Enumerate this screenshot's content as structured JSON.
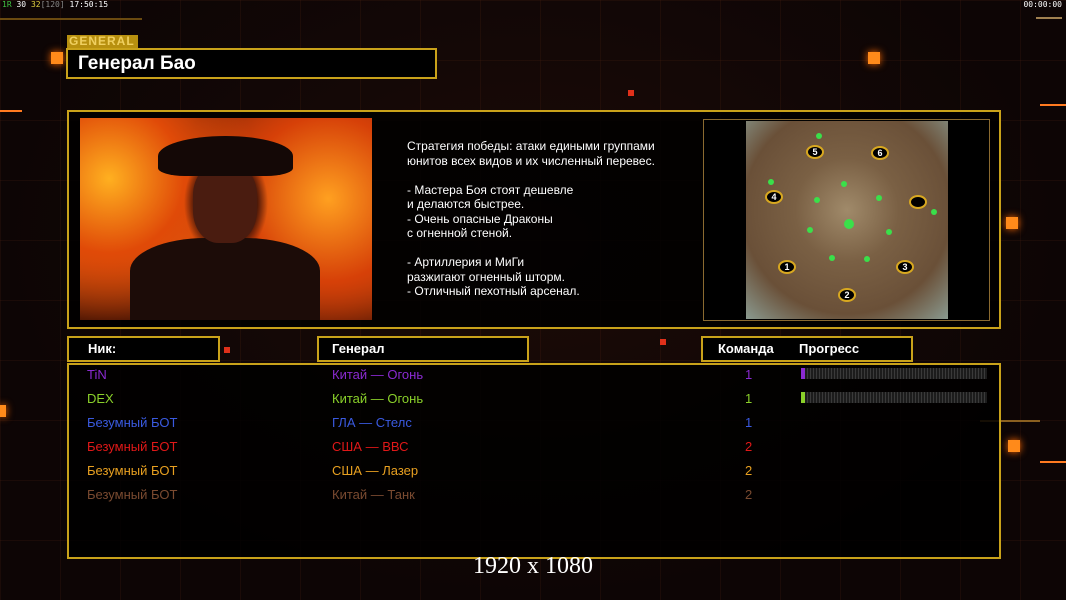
{
  "hud": {
    "left_fps_a": "1R",
    "left_fps_b": "30",
    "left_fps_c": "32",
    "left_fps_d": "[120]",
    "clock": "17:50:15",
    "timer": "00:00:00"
  },
  "header": {
    "tag": "GENERAL",
    "title": "Генерал Бао"
  },
  "description": "Стратегия победы: атаки едиными группами\nюнитов всех видов и их численный перевес.\n\n- Мастера Боя стоят дешевле\nи делаются быстрее.\n- Очень опасные Драконы\nс огненной стеной.\n\n- Артиллерия и МиГи\nразжигают огненный шторм.\n- Отличный пехотный арсенал.",
  "map": {
    "spawns": [
      "1",
      "2",
      "3",
      "4",
      "5",
      "6"
    ]
  },
  "columns": {
    "nick": "Ник:",
    "general": "Генерал",
    "team": "Команда",
    "progress": "Прогресс"
  },
  "players": [
    {
      "nick": "TiN",
      "general": "Китай — Огонь",
      "team": "1",
      "color": "#8a2ad0",
      "progress": 2
    },
    {
      "nick": "DEX",
      "general": "Китай — Огонь",
      "team": "1",
      "color": "#8ad02a",
      "progress": 2
    },
    {
      "nick": "Безумный БОТ",
      "general": "ГЛА — Стелс",
      "team": "1",
      "color": "#3a5ae0",
      "progress": null
    },
    {
      "nick": "Безумный БОТ",
      "general": "США — ВВС",
      "team": "2",
      "color": "#e01818",
      "progress": null
    },
    {
      "nick": "Безумный БОТ",
      "general": "США — Лазер",
      "team": "2",
      "color": "#e8a020",
      "progress": null
    },
    {
      "nick": "Безумный БОТ",
      "general": "Китай — Танк",
      "team": "2",
      "color": "#7a4a30",
      "progress": null
    }
  ],
  "resolution": "1920 x 1080"
}
